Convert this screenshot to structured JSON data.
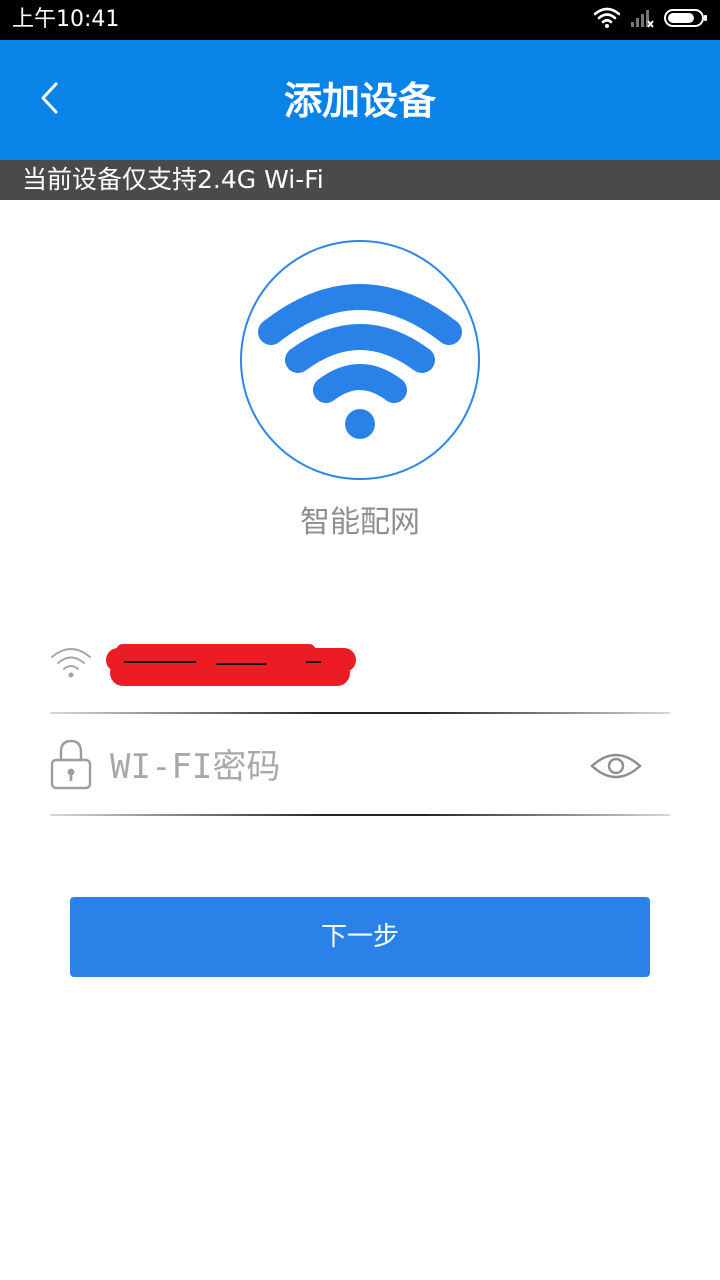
{
  "status_bar": {
    "time": "上午10:41",
    "icons": [
      "wifi-icon",
      "signal-icon",
      "battery-icon"
    ]
  },
  "header": {
    "title": "添加设备",
    "back_icon": "chevron-left-icon"
  },
  "notice": {
    "text": "当前设备仅支持2.4G Wi-Fi"
  },
  "hero": {
    "icon": "wifi-icon",
    "label": "智能配网"
  },
  "form": {
    "ssid": {
      "icon": "wifi-icon",
      "value_redacted": true
    },
    "password": {
      "icon": "lock-icon",
      "placeholder": "WI-FI密码",
      "value": "",
      "toggle_icon": "eye-icon"
    }
  },
  "actions": {
    "next_label": "下一步"
  },
  "colors": {
    "primary": "#0a83e8",
    "button": "#2a82e8",
    "notice_bg": "#4a4a4a",
    "redaction": "#ec1c24"
  }
}
